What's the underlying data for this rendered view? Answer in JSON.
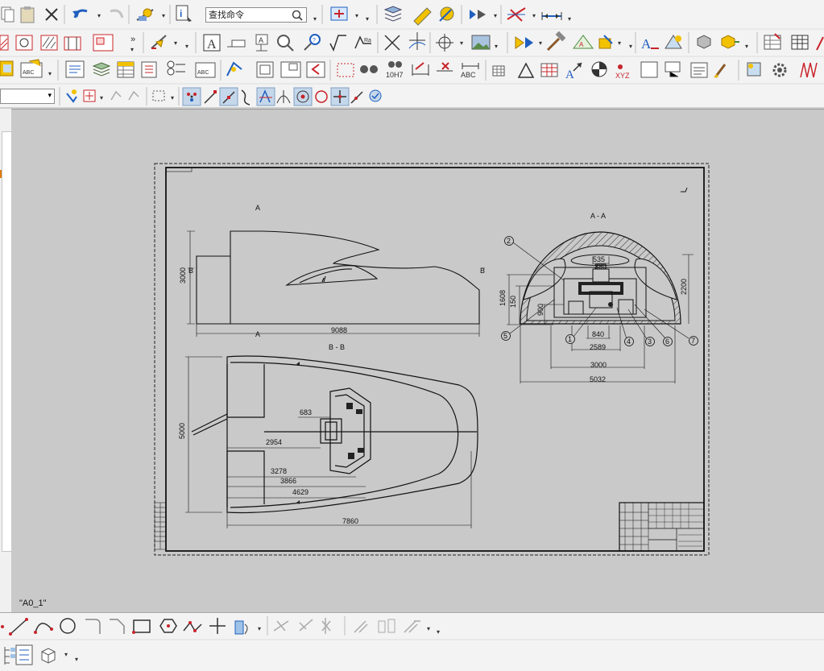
{
  "toolbar": {
    "search_placeholder": "查找命令",
    "glyph_10h7": "10H7",
    "glyph_abc": "ABC",
    "glyph_xyz": "XYZ",
    "glyph_overflow": "»"
  },
  "drawing": {
    "sheet_name": "\"A0_1\"",
    "section_aa_title": "A - A",
    "section_bb_title": "B - B",
    "mark_a_top": "A",
    "mark_a_bottom": "A",
    "mark_b_left": "B",
    "mark_b_right": "B",
    "side_view_dims": {
      "length": "9088",
      "height": "3000"
    },
    "plan_view_dims": {
      "width": "5000",
      "d683": "683",
      "d2954": "2954",
      "d3278": "3278",
      "d3866": "3866",
      "d4629": "4629",
      "d7860": "7860"
    },
    "section_dims": {
      "d535": "535",
      "d380": "380",
      "d1608": "1608",
      "d150": "150",
      "d900": "900",
      "d2200": "2200",
      "d840": "840",
      "d2589": "2589",
      "d3000": "3000",
      "d5032": "5032"
    },
    "balloons": [
      "1",
      "2",
      "3",
      "4",
      "5",
      "6",
      "7"
    ]
  },
  "colors": {
    "canvas": "#c9c9c9",
    "toolbar": "#f3f3f3",
    "accent_blue": "#1f5fbf",
    "accent_red": "#c8242a",
    "accent_gold": "#e0a400"
  }
}
